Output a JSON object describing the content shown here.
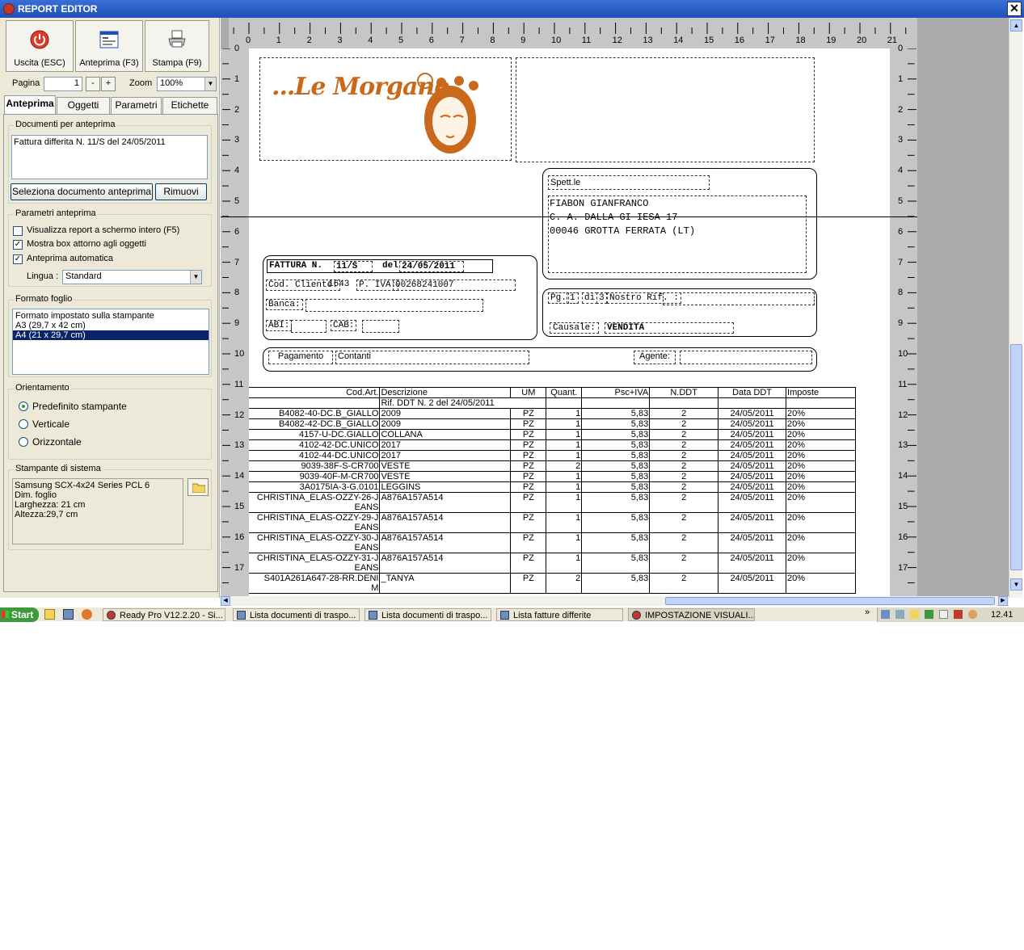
{
  "window": {
    "title": "REPORT EDITOR",
    "close": "✕"
  },
  "toolbar": {
    "exit": "Uscita (ESC)",
    "preview": "Anteprima (F3)",
    "print": "Stampa (F9)"
  },
  "nav": {
    "page_label": "Pagina",
    "page_value": "1",
    "minus": "-",
    "plus": "+",
    "zoom_label": "Zoom",
    "zoom_value": "100%"
  },
  "tabs": [
    "Anteprima",
    "Oggetti",
    "Parametri",
    "Etichette"
  ],
  "docs": {
    "group_label": "Documenti per anteprima",
    "item": "Fattura differita N. 11/S del 24/05/2011",
    "select_btn": "Seleziona documento anteprima",
    "remove_btn": "Rimuovi"
  },
  "params": {
    "group_label": "Parametri anteprima",
    "opt1": "Visualizza report a schermo intero (F5)",
    "opt2": "Mostra box attorno agli oggetti",
    "opt3": "Anteprima automatica",
    "lang_label": "Lingua :",
    "lang_value": "Standard"
  },
  "format": {
    "group_label": "Formato foglio",
    "items": [
      "Formato impostato sulla stampante",
      "A3 (29,7 x 42 cm)",
      "A4 (21 x 29,7 cm)"
    ],
    "selected_index": 2
  },
  "orient": {
    "group_label": "Orientamento",
    "opt1": "Predefinito stampante",
    "opt2": "Verticale",
    "opt3": "Orizzontale"
  },
  "printer": {
    "group_label": "Stampante di sistema",
    "lines": [
      "Samsung SCX-4x24 Series PCL 6",
      "Dim. foglio",
      "Larghezza: 21 cm",
      "Altezza:29,7 cm"
    ]
  },
  "ruler": {
    "h": [
      "0",
      "1",
      "2",
      "3",
      "4",
      "5",
      "6",
      "7",
      "8",
      "9",
      "10",
      "11",
      "12",
      "13",
      "14",
      "15",
      "16",
      "17",
      "18",
      "19",
      "20",
      "21"
    ],
    "v": [
      "0",
      "1",
      "2",
      "3",
      "4",
      "5",
      "6",
      "7",
      "8",
      "9",
      "10",
      "11",
      "12",
      "13",
      "14",
      "15",
      "16",
      "17"
    ]
  },
  "report": {
    "logo_text": "...Le Morgane",
    "spett": "Spett.le",
    "addr": [
      "FIABON GIANFRANCO",
      "C. A. DALLA GI IESA 17",
      "00046 GROTTA FERRATA (LT)"
    ],
    "fattura_label": "FATTURA N.",
    "fattura_num": "11/S",
    "del_label": "del",
    "del_date": "24/05/2011",
    "cliente_label": "Cod. Cliente:",
    "cliente_val": "1643",
    "piva_label": "P. IVA:",
    "piva_val": "00268241007",
    "banca_label": "Banca:",
    "abi_label": "ABI:",
    "cab_label": "CAB:",
    "pg_label": "Pg.",
    "pg_val": "1",
    "di_label": "di",
    "di_val": "3",
    "rif_label": "Nostro Rif. :",
    "causale_label": "Causale:",
    "causale_val": "VENDITA",
    "pagamento_label": "Pagamento",
    "pagamento_val": "Contanti",
    "agente_label": "Agente:",
    "headers": [
      "Cod.Art.",
      "Descrizione",
      "UM",
      "Quant.",
      "Psc+IVA",
      "N.DDT",
      "Data DDT",
      "Imposte"
    ],
    "rif_row": "Rif. DDT N. 2 del 24/05/2011",
    "rows": [
      [
        "B4082-40-DC.B_GIALLO",
        "2009",
        "PZ",
        "1",
        "5,83",
        "2",
        "24/05/2011",
        "20%"
      ],
      [
        "B4082-42-DC.B_GIALLO",
        "2009",
        "PZ",
        "1",
        "5,83",
        "2",
        "24/05/2011",
        "20%"
      ],
      [
        "4157-U-DC.GIALLO",
        "COLLANA",
        "PZ",
        "1",
        "5,83",
        "2",
        "24/05/2011",
        "20%"
      ],
      [
        "4102-42-DC.UNICO",
        "2017",
        "PZ",
        "1",
        "5,83",
        "2",
        "24/05/2011",
        "20%"
      ],
      [
        "4102-44-DC.UNICO",
        "2017",
        "PZ",
        "1",
        "5,83",
        "2",
        "24/05/2011",
        "20%"
      ],
      [
        "9039-38F-S-CR700",
        "VESTE",
        "PZ",
        "2",
        "5,83",
        "2",
        "24/05/2011",
        "20%"
      ],
      [
        "9039-40F-M-CR700",
        "VESTE",
        "PZ",
        "1",
        "5,83",
        "2",
        "24/05/2011",
        "20%"
      ],
      [
        "3A0175IA-3-G.0101",
        "LEGGINS",
        "PZ",
        "1",
        "5,83",
        "2",
        "24/05/2011",
        "20%"
      ]
    ],
    "rows2": [
      [
        "CHRISTINA_ELAS-OZZY-26-J",
        "EANS",
        "A876A157A514",
        "PZ",
        "1",
        "5,83",
        "2",
        "24/05/2011",
        "20%"
      ],
      [
        "CHRISTINA_ELAS-OZZY-29-J",
        "EANS",
        "A876A157A514",
        "PZ",
        "1",
        "5,83",
        "2",
        "24/05/2011",
        "20%"
      ],
      [
        "CHRISTINA_ELAS-OZZY-30-J",
        "EANS",
        "A876A157A514",
        "PZ",
        "1",
        "5,83",
        "2",
        "24/05/2011",
        "20%"
      ],
      [
        "CHRISTINA_ELAS-OZZY-31-J",
        "EANS",
        "A876A157A514",
        "PZ",
        "1",
        "5,83",
        "2",
        "24/05/2011",
        "20%"
      ],
      [
        "S401A261A647-28-RR.DENI",
        "M",
        "_TANYA",
        "PZ",
        "2",
        "5,83",
        "2",
        "24/05/2011",
        "20%"
      ]
    ]
  },
  "taskbar": {
    "start": "Start",
    "tasks": [
      "Ready Pro V12.2.20 - Si...",
      "Lista documenti di traspo...",
      "Lista documenti di traspo...",
      "Lista fatture differite",
      "IMPOSTAZIONE VISUALI..."
    ],
    "chevron": "»",
    "clock": "12.41"
  },
  "colors": {
    "logo": "#c8691c",
    "titlebar": "#2458c8",
    "selection": "#0a246a"
  }
}
